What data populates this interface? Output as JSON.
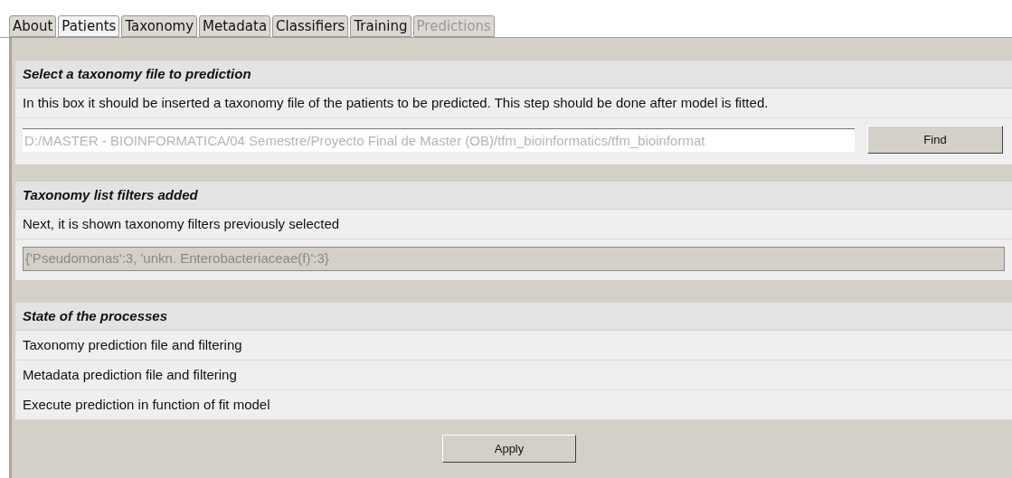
{
  "tabs": [
    {
      "label": "About",
      "selected": false,
      "disabled": false
    },
    {
      "label": "Patients",
      "selected": true,
      "disabled": false
    },
    {
      "label": "Taxonomy",
      "selected": false,
      "disabled": false
    },
    {
      "label": "Metadata",
      "selected": false,
      "disabled": false
    },
    {
      "label": "Classifiers",
      "selected": false,
      "disabled": false
    },
    {
      "label": "Training",
      "selected": false,
      "disabled": false
    },
    {
      "label": "Predictions",
      "selected": false,
      "disabled": true
    }
  ],
  "file_section": {
    "title": "Select a taxonomy file to prediction",
    "description": "In this box it should be inserted a taxonomy file of the patients to be predicted. This step should be done after model is fitted.",
    "path_field": {
      "placeholder": "D:/MASTER - BIOINFORMATICA/04 Semestre/Proyecto Final de Master (OB)/tfm_bioinformatics/tfm_bioinformat"
    },
    "find_button": "Find"
  },
  "filters_section": {
    "title": "Taxonomy list filters added",
    "description": "Next, it is shown taxonomy filters previously selected",
    "filters_field": {
      "value": "{'Pseudomonas':3, 'unkn. Enterobacteriaceae(f)':3}"
    }
  },
  "processes_section": {
    "title": "State of the processes",
    "items": [
      "Taxonomy prediction file and filtering",
      "Metadata prediction file and filtering",
      "Execute prediction in function of fit model"
    ]
  },
  "apply_button": "Apply"
}
